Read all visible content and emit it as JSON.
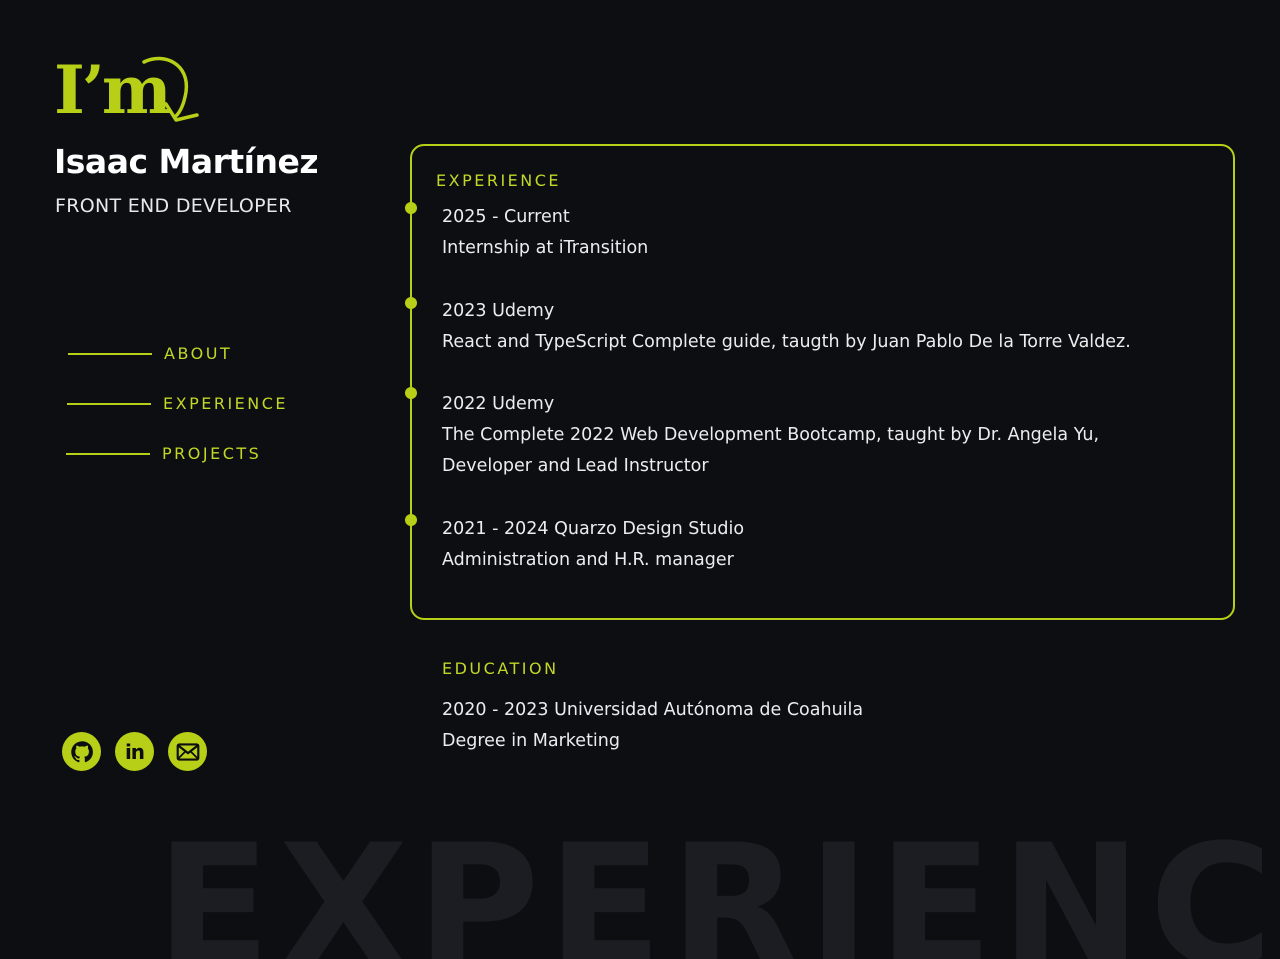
{
  "watermark": "EXPERIENCE",
  "logo": {
    "text": "I’m",
    "icon": "curved-arrow-icon"
  },
  "profile": {
    "name": "Isaac Martínez",
    "role": "FRONT END DEVELOPER"
  },
  "nav": [
    {
      "label": "ABOUT"
    },
    {
      "label": "EXPERIENCE"
    },
    {
      "label": "PROJECTS"
    }
  ],
  "socials": [
    {
      "icon": "github-icon"
    },
    {
      "icon": "linkedin-icon",
      "text": "in"
    },
    {
      "icon": "email-icon"
    }
  ],
  "experience": {
    "title": "EXPERIENCE",
    "items": [
      {
        "period": "2025 - Current",
        "description": "Internship at iTransition"
      },
      {
        "period": "2023 Udemy",
        "description": "React and TypeScript Complete guide, taugth by Juan Pablo De la Torre Valdez."
      },
      {
        "period": "2022 Udemy",
        "description": "The Complete 2022 Web Development Bootcamp, taught by Dr. Angela Yu,",
        "description2": "Developer and Lead Instructor"
      },
      {
        "period": "2021 - 2024 Quarzo Design Studio",
        "description": "Administration and H.R. manager"
      }
    ]
  },
  "education": {
    "title": "EDUCATION",
    "items": [
      {
        "period": "2020 - 2023 Universidad Autónoma de Coahuila",
        "description": "Degree in Marketing"
      }
    ]
  },
  "colors": {
    "background": "#0c0e12",
    "accent": "#b8cf17",
    "text": "#ececec",
    "watermark": "#1b1d22"
  }
}
